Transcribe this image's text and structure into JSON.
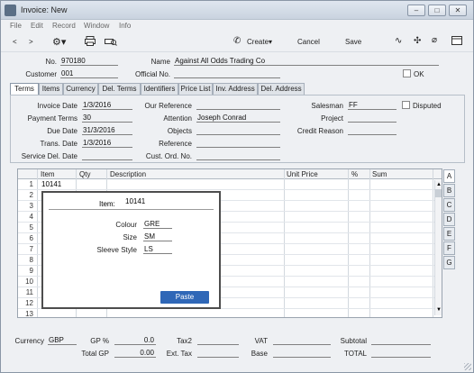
{
  "window": {
    "title": "Invoice: New",
    "controls": {
      "minimize": "–",
      "restore": "□",
      "close": "✕"
    }
  },
  "menu": [
    "File",
    "Edit",
    "Record",
    "Window",
    "Info"
  ],
  "toolbar": {
    "back": "<",
    "forward": ">",
    "create": "Create",
    "cancel": "Cancel",
    "save": "Save"
  },
  "header": {
    "no_label": "No.",
    "no_value": "970180",
    "name_label": "Name",
    "name_value": "Against All Odds Trading Co",
    "customer_label": "Customer",
    "customer_value": "001",
    "official_label": "Official No.",
    "official_value": "",
    "ok_label": "OK"
  },
  "tabs": [
    "Terms",
    "Items",
    "Currency",
    "Del. Terms",
    "Identifiers",
    "Price List",
    "Inv. Address",
    "Del. Address"
  ],
  "terms": {
    "invoice_date_label": "Invoice Date",
    "invoice_date": "1/3/2016",
    "payment_terms_label": "Payment Terms",
    "payment_terms": "30",
    "due_date_label": "Due Date",
    "due_date": "31/3/2016",
    "trans_date_label": "Trans. Date",
    "trans_date": "1/3/2016",
    "service_del_label": "Service Del. Date",
    "service_del": "",
    "our_ref_label": "Our Reference",
    "our_ref": "",
    "attention_label": "Attention",
    "attention": "Joseph Conrad",
    "objects_label": "Objects",
    "objects": "",
    "reference_label": "Reference",
    "reference": "",
    "cust_ord_label": "Cust. Ord. No.",
    "cust_ord": "",
    "salesman_label": "Salesman",
    "salesman": "FF",
    "disputed_label": "Disputed",
    "project_label": "Project",
    "project": "",
    "credit_reason_label": "Credit Reason",
    "credit_reason": ""
  },
  "grid": {
    "headers": {
      "item": "Item",
      "qty": "Qty",
      "description": "Description",
      "unit_price": "Unit Price",
      "pct": "%",
      "sum": "Sum"
    },
    "row_numbers": [
      "1",
      "2",
      "3",
      "4",
      "5",
      "6",
      "7",
      "8",
      "9",
      "10",
      "11",
      "12",
      "13"
    ],
    "row1_item": "10141",
    "side_tabs": [
      "A",
      "B",
      "C",
      "D",
      "E",
      "F",
      "G"
    ]
  },
  "popup": {
    "item_label": "Item:",
    "item_value": "10141",
    "colour_label": "Colour",
    "colour_value": "GRE",
    "size_label": "Size",
    "size_value": "SM",
    "sleeve_label": "Sleeve Style",
    "sleeve_value": "LS",
    "paste_button": "Paste"
  },
  "footer": {
    "currency_label": "Currency",
    "currency_value": "GBP",
    "gp_pct_label": "GP %",
    "gp_pct_value": "0.0",
    "total_gp_label": "Total GP",
    "total_gp_value": "0.00",
    "tax2_label": "Tax2",
    "tax2_value": "",
    "ext_tax_label": "Ext. Tax",
    "ext_tax_value": "",
    "vat_label": "VAT",
    "vat_value": "",
    "base_label": "Base",
    "base_value": "",
    "subtotal_label": "Subtotal",
    "subtotal_value": "",
    "total_label": "TOTAL",
    "total_value": ""
  },
  "colors": {
    "accent": "#2f67b7"
  }
}
